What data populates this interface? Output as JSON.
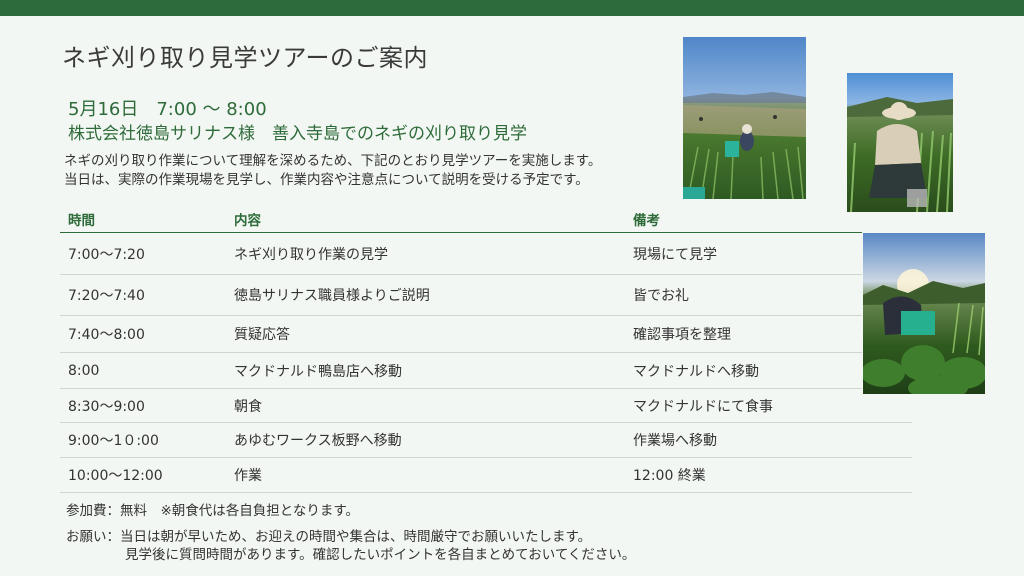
{
  "title": "ネギ刈り取り見学ツアーのご案内",
  "datetime": "5月16日　7:00 ～ 8:00",
  "organization": "株式会社徳島サリナス様　善入寺島でのネギの刈り取り見学",
  "intro": [
    "ネギの刈り取り作業について理解を深めるため、下記のとおり見学ツアーを実施します。",
    "当日は、実際の作業現場を見学し、作業内容や注意点について説明を受ける予定です。"
  ],
  "schedule": {
    "headers": [
      "時間",
      "内容",
      "備考"
    ],
    "rows": [
      {
        "time": "7:00～7:20",
        "content": "ネギ刈り取り作業の見学",
        "note": "現場にて見学"
      },
      {
        "time": "7:20～7:40",
        "content": "徳島サリナス職員様よりご説明",
        "note": "皆でお礼"
      },
      {
        "time": "7:40～8:00",
        "content": "質疑応答",
        "note": "確認事項を整理"
      },
      {
        "time": "8:00",
        "content": "マクドナルド鴨島店へ移動",
        "note": "マクドナルドへ移動"
      },
      {
        "time": "8:30～9:00",
        "content": "朝食",
        "note": "マクドナルドにて食事"
      },
      {
        "time": "9:00～1０:00",
        "content": "あゆむワークス板野へ移動",
        "note": "作業場へ移動"
      },
      {
        "time": "10:00～12:00",
        "content": "作業",
        "note": "12:00 終業"
      }
    ]
  },
  "notes": {
    "fee": "参加費：無料　※朝食代は各自負担となります。",
    "request_line1": "お願い：当日は朝が早いため、お迎えの時間や集合は、時間厳守でお願いいたします。",
    "request_line2": "見学後に質問時間があります。確認したいポイントを各自まとめておいてください。"
  },
  "colors": {
    "accent": "#2e6b3a",
    "background": "#f3f7f3"
  }
}
